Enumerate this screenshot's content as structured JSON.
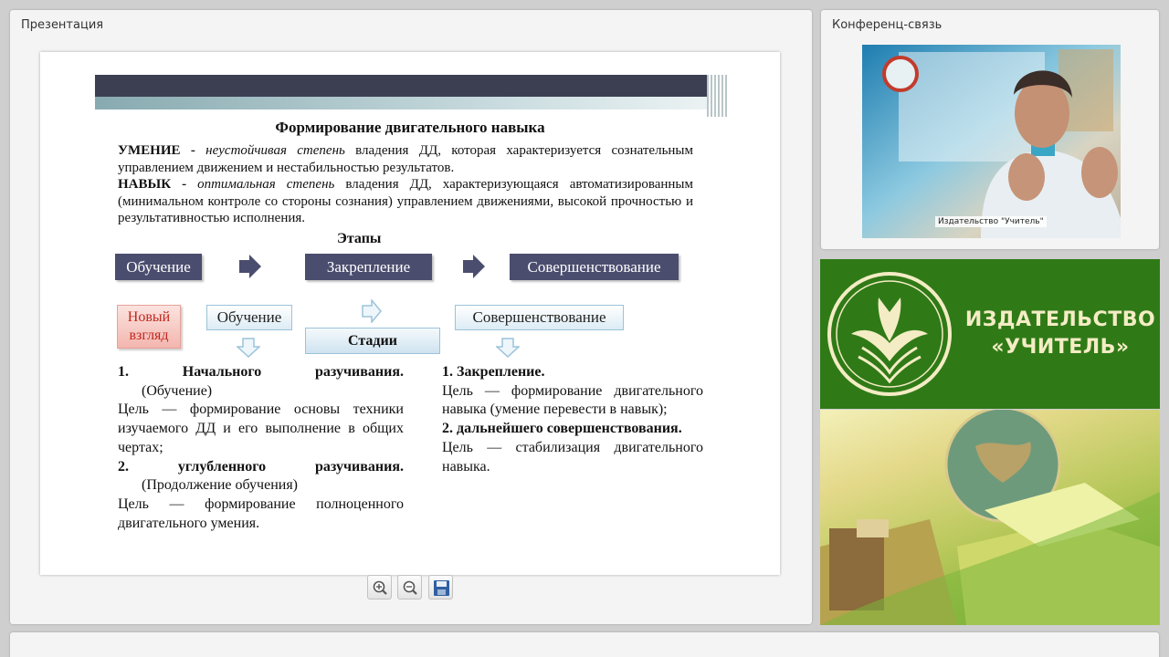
{
  "presentation_panel": {
    "title": "Презентация"
  },
  "conference_panel": {
    "title": "Конференц-связь",
    "video_caption": "Издательство \"Учитель\""
  },
  "slide": {
    "heading": "Формирование двигательного навыка",
    "umenie": {
      "term": "УМЕНИЕ",
      "dash": " - ",
      "quality": "неустойчивая степень",
      "text": " владения ДД, которая характеризуется сознательным управлением движением и нестабильностью результатов."
    },
    "navyk": {
      "term": "НАВЫК",
      "dash": " - ",
      "quality": "оптимальная степень",
      "text": " владения ДД, характеризующаяся автоматизированным (минимальном контроле со стороны сознания) управлением движениями, высокой прочностью и результативностью исполнения."
    },
    "etapy_title": "Этапы",
    "etapy": [
      "Обучение",
      "Закрепление",
      "Совершенствование"
    ],
    "new_look": "Новый взгляд",
    "stage_labels": {
      "obuchenie": "Обучение",
      "sovershenstvovanie": "Совершенствование",
      "stadii": "Стадии"
    },
    "left_column": {
      "item1_title": "1. Начального разучивания.",
      "item1_sub": "(Обучение)",
      "item1_goal": "Цель — формирование основы техники изучаемого ДД и его выполнение в общих чертах;",
      "item2_title": "2. углубленного разучивания.",
      "item2_sub": "(Продолжение обучения)",
      "item2_goal": "Цель — формирование полноценного двигательного умения."
    },
    "right_column": {
      "item1_title": "1. Закрепление.",
      "item1_goal": "Цель — формирование двигательного навыка (умение перевести в навык);",
      "item2_title": "2. дальнейшего совершенствования.",
      "item2_goal": "Цель — стабилизация двигательного навыка."
    }
  },
  "toolbar": {
    "icons": [
      "zoom-in-icon",
      "zoom-out-icon",
      "save-icon"
    ]
  },
  "brand": {
    "line1": "ИЗДАТЕЛЬСТВО",
    "line2": "«УЧИТЕЛЬ»",
    "color": "#2f7a17"
  },
  "colors": {
    "stage_box": "#4a4d6e",
    "new_look_text": "#c0271e"
  }
}
